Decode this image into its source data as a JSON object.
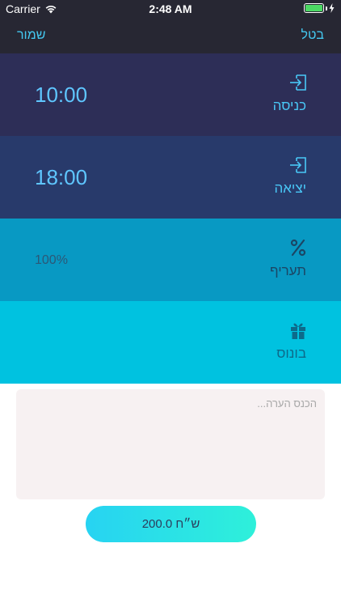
{
  "status_bar": {
    "carrier": "Carrier",
    "time": "2:48 AM",
    "battery_percent": 100,
    "wifi_icon": "wifi-icon",
    "battery_icon": "battery-icon",
    "charging_icon": "lightning-icon"
  },
  "nav": {
    "left_label": "שמור",
    "right_label": "בטל"
  },
  "rows": [
    {
      "label": "כניסה",
      "value": "10:00",
      "icon": "sign-in-icon"
    },
    {
      "label": "יציאה",
      "value": "18:00",
      "icon": "sign-out-icon"
    },
    {
      "label": "תעריף",
      "value": "100%",
      "icon": "percent-icon"
    },
    {
      "label": "בונוס",
      "value": "",
      "icon": "gift-icon"
    }
  ],
  "note": {
    "placeholder": "הכנס הערה...",
    "value": ""
  },
  "total_button": {
    "label": "200.0 ש״ח"
  },
  "colors": {
    "nav_background": "#272733",
    "accent": "#44c8f0",
    "row_1": "#2d2e57",
    "row_2": "#283a6b",
    "row_3": "#0899c3",
    "row_4": "#00c2e0",
    "note_background": "#f7f1f2",
    "button_gradient_start": "#27d3f2",
    "button_gradient_end": "#2ef0da"
  }
}
